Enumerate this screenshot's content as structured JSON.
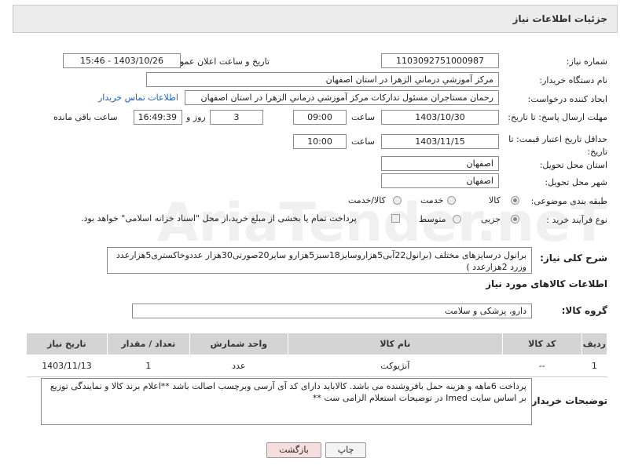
{
  "header": {
    "title": "جزئیات اطلاعات نیاز"
  },
  "fields": {
    "need_number_label": "شماره نیاز:",
    "need_number": "1103092751000987",
    "announce_label": "تاریخ و ساعت اعلان عمومی:",
    "announce_value": "1403/10/26 - 15:46",
    "buyer_org_label": "نام دستگاه خریدار:",
    "buyer_org": "مرکز آموزشي درماني الزهرا در استان اصفهان",
    "creator_label": "ایجاد کننده درخواست:",
    "creator": "رحمان مستاجران مسئول تدارکات مرکز آموزشي درماني الزهرا در استان اصفهان",
    "contact_link": "اطلاعات تماس خریدار",
    "reply_deadline_label": "مهلت ارسال پاسخ: تا تاریخ:",
    "reply_date": "1403/10/30",
    "time_label": "ساعت",
    "reply_time": "09:00",
    "days_value": "3",
    "days_label": "روز و",
    "remaining_time": "16:49:39",
    "remaining_label": "ساعت باقی مانده",
    "price_validity_label": "حداقل تاریخ اعتبار قیمت: تا تاریخ:",
    "price_date": "1403/11/15",
    "price_time": "10:00",
    "province_label": "استان محل تحویل:",
    "province": "اصفهان",
    "city_label": "شهر محل تحویل:",
    "city": "اصفهان",
    "category_label": "طبقه بندی موضوعی:",
    "category_options": [
      "کالا",
      "خدمت",
      "کالا/خدمت"
    ],
    "process_label": "نوع فرآیند خرید :",
    "process_options": [
      "جزیی",
      "متوسط"
    ],
    "payment_note": "پرداخت تمام یا بخشی از مبلغ خرید،از محل \"اسناد خزانه اسلامی\" خواهد بود."
  },
  "description": {
    "label": "شرح کلی نیاز:",
    "text": "برانول درسایزهای مختلف (برانول22آبی5هزاروسایز18سبز5هزارو سایر20صورتی30هزار عددوخاکستری5هزارعدد وزرد 2هزارعدد )"
  },
  "goods_info": {
    "section_title": "اطلاعات کالاهای مورد نیاز",
    "group_label": "گروه کالا:",
    "group_value": "دارو، پزشکی و سلامت"
  },
  "table": {
    "headers": [
      "ردیف",
      "کد کالا",
      "نام کالا",
      "واحد شمارش",
      "تعداد / مقدار",
      "تاریخ نیاز"
    ],
    "rows": [
      {
        "row": "1",
        "code": "--",
        "name": "آنژیوکت",
        "unit": "عدد",
        "qty": "1",
        "date": "1403/11/13"
      }
    ]
  },
  "buyer_notes": {
    "label": "توضیحات خریدار:",
    "text": "پرداخت 6ماهه و  هزینه حمل بافروشنده می باشد. کالاباید دارای کد آی آرسی وبرچسب اصالت باشد  **اعلام برند کالا و نمایندگی توزیع بر اساس سایت Imed در توضیحات استعلام الزامی ست **"
  },
  "buttons": {
    "print": "چاپ",
    "back": "بازگشت"
  },
  "watermark": "AriaTender.neT",
  "colors": {
    "link": "#1f5fbf",
    "back_button_bg": "#f7dede",
    "header_bg": "#ececec",
    "table_header_bg": "#d4d4d4"
  }
}
